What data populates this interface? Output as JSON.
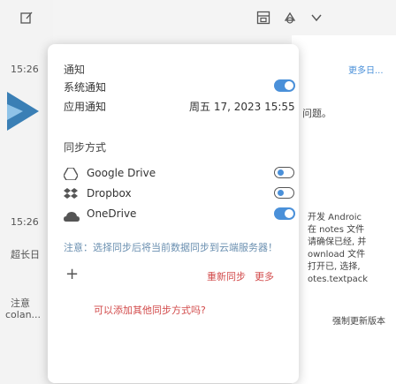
{
  "colors": {
    "accent": "#4a90d9",
    "link_red": "#d24a4a"
  },
  "left": {
    "times": [
      "15:26",
      "15:26"
    ],
    "text1": "超长日",
    "text2": "注意",
    "text3": "colan..."
  },
  "right": {
    "top_link": "更多日...",
    "title": "问题。",
    "lines": [
      "开发 Androic",
      "在 notes 文件",
      "请确保已经, 并",
      "ownload 文件",
      "打开已, 选择,",
      "otes.textpack"
    ],
    "bottom": "强制更新版本"
  },
  "popup": {
    "section1_title": "通知",
    "row1_label": "系统通知",
    "row2_label": "应用通知",
    "time_label": "周五 17, 2023  15:55",
    "section2_title": "同步方式",
    "services": [
      {
        "label": "Google Drive",
        "icon": "google-drive-icon",
        "state": "off"
      },
      {
        "label": "Dropbox",
        "icon": "dropbox-icon",
        "state": "off"
      },
      {
        "label": "OneDrive",
        "icon": "onedrive-icon",
        "state": "on"
      }
    ],
    "tip": "注意：选择同步后将当前数据同步到云端服务器！",
    "add_symbol": "+",
    "link1": "重新同步",
    "link2": "更多",
    "footer_question": "可以添加其他同步方式吗?"
  }
}
